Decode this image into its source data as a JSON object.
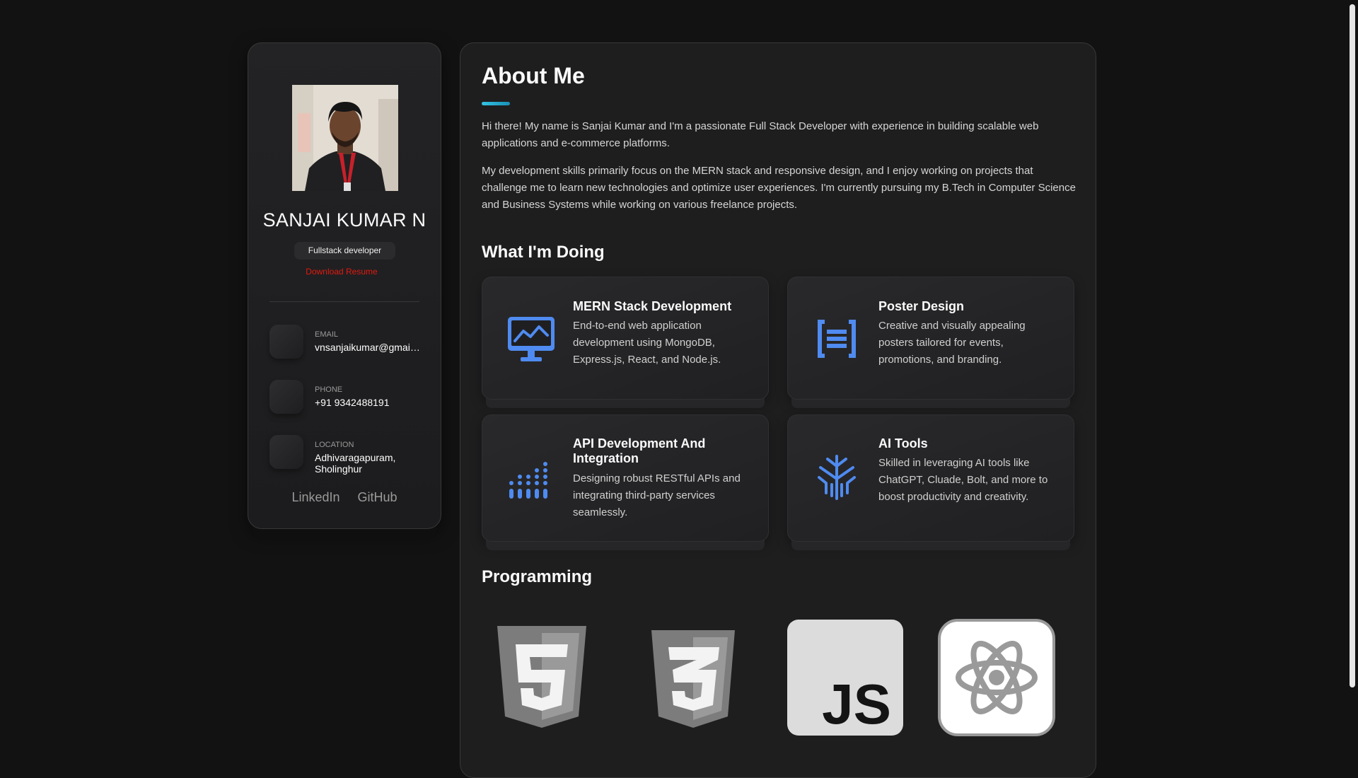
{
  "sidebar": {
    "name": "SANJAI KUMAR N",
    "role": "Fullstack developer",
    "resume_link": "Download Resume",
    "contacts": [
      {
        "label": "EMAIL",
        "value": "vnsanjaikumar@gmail.com"
      },
      {
        "label": "PHONE",
        "value": "+91 9342488191"
      },
      {
        "label": "LOCATION",
        "value": "Adhivaragapuram, Sholinghur"
      }
    ],
    "socials": [
      "LinkedIn",
      "GitHub"
    ]
  },
  "about": {
    "title": "About Me",
    "paragraphs": [
      "Hi there! My name is Sanjai Kumar and I'm a passionate Full Stack Developer with experience in building scalable web applications and e-commerce platforms.",
      "My development skills primarily focus on the MERN stack and responsive design, and I enjoy working on projects that challenge me to learn new technologies and optimize user experiences. I'm currently pursuing my B.Tech in Computer Science and Business Systems while working on various freelance projects."
    ]
  },
  "doing": {
    "title": "What I'm Doing",
    "services": [
      {
        "icon": "monitor-chart-icon",
        "title": "MERN Stack Development",
        "desc": "End-to-end web application development using MongoDB, Express.js, React, and Node.js."
      },
      {
        "icon": "document-lines-icon",
        "title": "Poster Design",
        "desc": "Creative and visually appealing posters tailored for events, promotions, and branding."
      },
      {
        "icon": "dot-bars-icon",
        "title": "API Development And Integration",
        "desc": "Designing robust RESTful APIs and integrating third-party services seamlessly."
      },
      {
        "icon": "ai-tree-icon",
        "title": "AI Tools",
        "desc": "Skilled in leveraging AI tools like ChatGPT, Cluade, Bolt, and more to boost productivity and creativity."
      }
    ]
  },
  "programming": {
    "title": "Programming",
    "logos": [
      "html5-icon",
      "css3-icon",
      "javascript-icon",
      "react-icon"
    ],
    "js_text": "JS"
  },
  "colors": {
    "accent_blue": "#4f8bf0",
    "resume_red": "#e3190f",
    "underline_cyan": "#33c5e4",
    "background": "#121212"
  }
}
